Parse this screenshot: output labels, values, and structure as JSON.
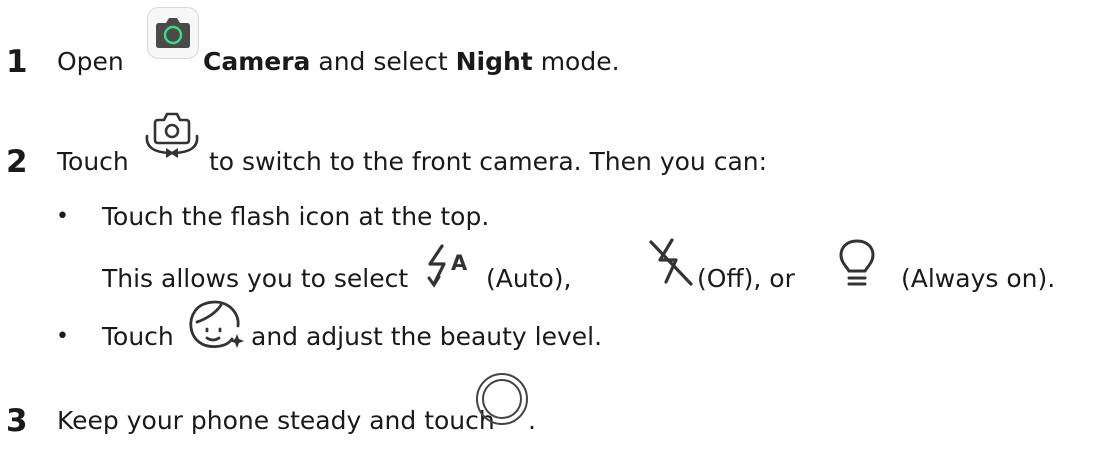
{
  "steps": [
    {
      "number": "1",
      "text_open": "Open",
      "app_name": "Camera",
      "text_mid": "and select",
      "mode": "Night",
      "text_end": "mode."
    },
    {
      "number": "2",
      "text_before": "Touch",
      "text_after": "to switch to the front camera. Then you can:"
    },
    {
      "number": "3",
      "text_before": "Keep your phone steady and touch",
      "text_after": "."
    }
  ],
  "substeps": [
    {
      "bullet": "•",
      "text": "Touch the flash icon at the top."
    },
    {
      "bullet": "•",
      "text_before": "Touch",
      "text_after": "and adjust the beauty level."
    }
  ],
  "flash_options": {
    "intro": "This allows you to select",
    "auto": "(Auto),",
    "off": "(Off), or",
    "always_on": "(Always on)."
  },
  "icons": {
    "camera_app": "camera-app-icon",
    "switch_camera": "switch-camera-icon",
    "flash_auto": "flash-auto-icon",
    "flash_off": "flash-off-icon",
    "flash_always_on": "bulb-icon",
    "beauty": "beauty-face-icon",
    "shutter": "shutter-icon",
    "camera_app_lens_color": "#3ddc84"
  }
}
